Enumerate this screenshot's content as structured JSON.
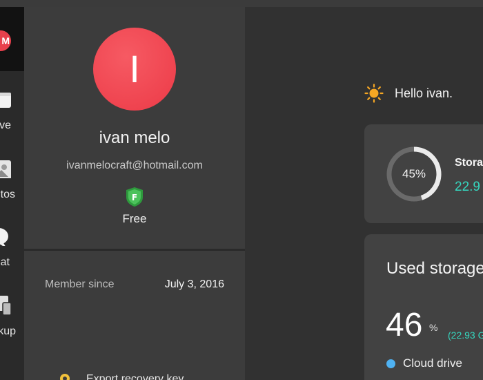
{
  "sidebar": {
    "items": [
      {
        "label": "ve",
        "icon": "drive-icon"
      },
      {
        "label": "tos",
        "icon": "photos-icon"
      },
      {
        "label": "at",
        "icon": "chat-icon"
      },
      {
        "label": "kup",
        "icon": "backup-icon"
      }
    ]
  },
  "profile": {
    "avatar_initial": "I",
    "name": "ivan melo",
    "email": "ivanmelocraft@hotmail.com",
    "plan_badge_letter": "F",
    "plan": "Free"
  },
  "details": {
    "member_since_label": "Member since",
    "member_since_value": "July 3, 2016",
    "export_label": "Export recovery key"
  },
  "greeting": {
    "text": "Hello ivan."
  },
  "storage_card": {
    "percent_text": "45%",
    "percent": 45,
    "title": "Stora",
    "amount": "22.9"
  },
  "used_card": {
    "title": "Used storage",
    "percent": "46",
    "percent_sign": "%",
    "amount": "(22.93 G",
    "legend": [
      {
        "label": "Cloud drive",
        "color": "#4fb2f2"
      }
    ]
  },
  "colors": {
    "accent_red": "#ec3a47",
    "teal": "#35d7bf",
    "badge_green": "#3fb34f",
    "sun": "#f5a623"
  }
}
